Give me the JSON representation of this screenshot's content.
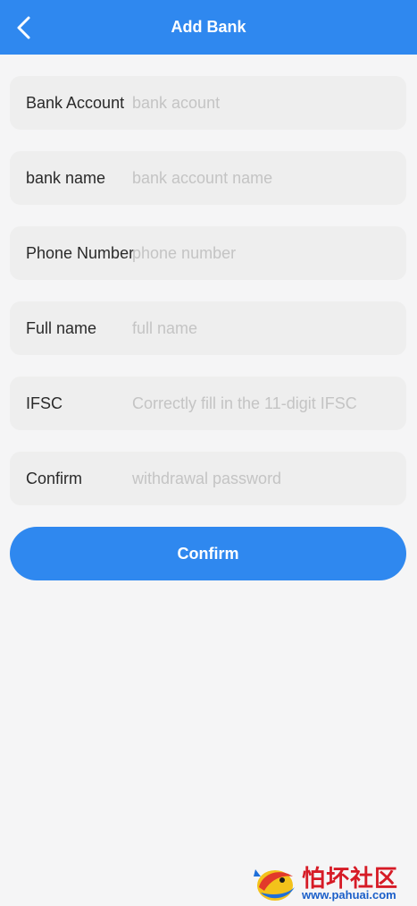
{
  "header": {
    "title": "Add Bank",
    "background_color": "#2f88ef",
    "back_icon": "chevron-left-icon"
  },
  "form": {
    "fields": [
      {
        "label": "Bank Account",
        "placeholder": "bank acount",
        "value": ""
      },
      {
        "label": "bank name",
        "placeholder": "bank account name",
        "value": ""
      },
      {
        "label": "Phone Number",
        "placeholder": "phone number",
        "value": ""
      },
      {
        "label": "Full name",
        "placeholder": "full name",
        "value": ""
      },
      {
        "label": "IFSC",
        "placeholder": "Correctly fill in the 11-digit IFSC",
        "value": ""
      },
      {
        "label": "Confirm",
        "placeholder": "withdrawal password",
        "value": ""
      }
    ]
  },
  "confirm_button": {
    "label": "Confirm",
    "color": "#2f88ef"
  },
  "watermark": {
    "chinese_text": "怕坏社区",
    "url": "www.pahuai.com"
  }
}
